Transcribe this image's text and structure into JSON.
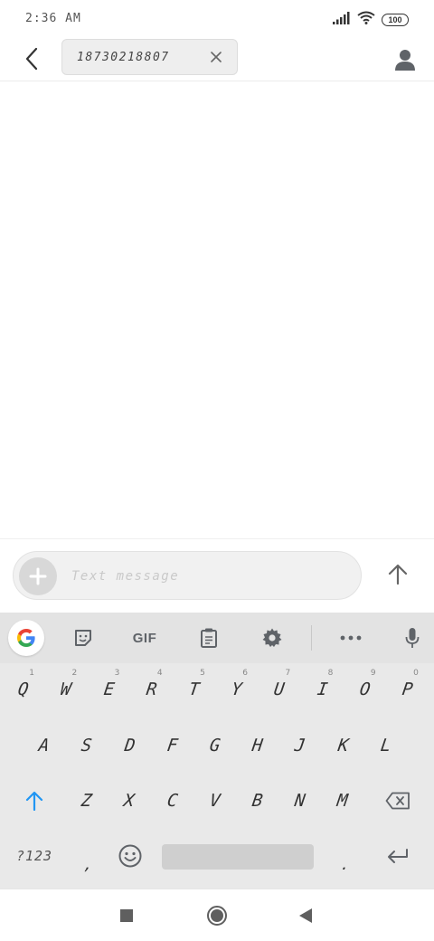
{
  "status_bar": {
    "time": "2:36 AM",
    "battery": "100",
    "icons": [
      "signal-icon",
      "wifi-icon",
      "battery-icon"
    ]
  },
  "app_bar": {
    "recipient": "18730218807",
    "icons": [
      "back-arrow-icon",
      "close-icon",
      "person-icon"
    ]
  },
  "compose": {
    "placeholder": "Text message",
    "value": "",
    "icons": [
      "plus-icon",
      "send-arrow-icon"
    ]
  },
  "keyboard": {
    "toolbar": {
      "gif_label": "GIF",
      "icons": [
        "google-icon",
        "sticker-icon",
        "gif-icon",
        "clipboard-icon",
        "gear-icon",
        "more-icon",
        "mic-icon"
      ]
    },
    "row1": [
      {
        "key": "Q",
        "hint": "1"
      },
      {
        "key": "W",
        "hint": "2"
      },
      {
        "key": "E",
        "hint": "3"
      },
      {
        "key": "R",
        "hint": "4"
      },
      {
        "key": "T",
        "hint": "5"
      },
      {
        "key": "Y",
        "hint": "6"
      },
      {
        "key": "U",
        "hint": "7"
      },
      {
        "key": "I",
        "hint": "8"
      },
      {
        "key": "O",
        "hint": "9"
      },
      {
        "key": "P",
        "hint": "0"
      }
    ],
    "row2": [
      "A",
      "S",
      "D",
      "F",
      "G",
      "H",
      "J",
      "K",
      "L"
    ],
    "row3": [
      "Z",
      "X",
      "C",
      "V",
      "B",
      "N",
      "M"
    ],
    "row4": {
      "symbols_label": "?123",
      "comma": ",",
      "period": "."
    },
    "accent_color": "#2196f3"
  },
  "nav_bar": {
    "icons": [
      "recents-square-icon",
      "home-circle-icon",
      "back-triangle-icon"
    ]
  }
}
